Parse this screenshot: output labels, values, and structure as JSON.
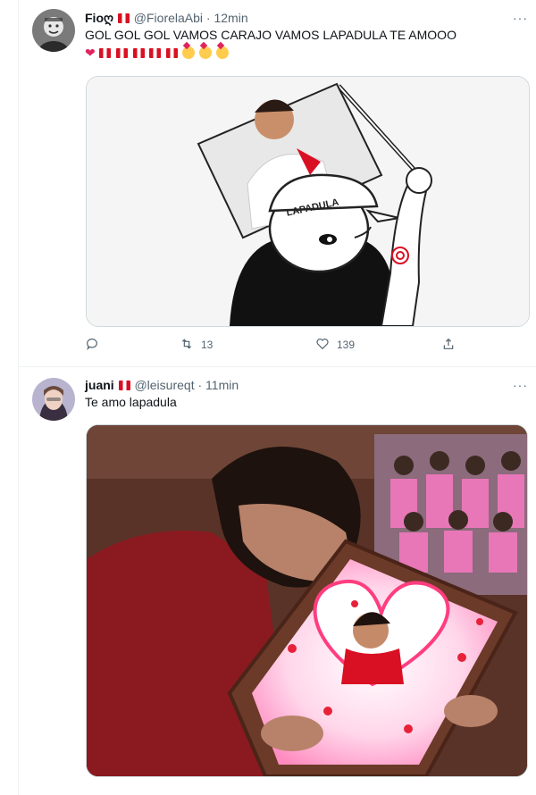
{
  "tweets": [
    {
      "display_name": "Fioღ",
      "handle": "@FiorelaAbi",
      "dot": "·",
      "time": "12min",
      "text": "GOL GOL GOL VAMOS CARAJO VAMOS LAPADULA TE AMOOO",
      "emoji_line": "❤️🇵🇪🇵🇪🇵🇪🇵🇪🇵🇪🥳🥳🥳",
      "media": {
        "type": "meme-drawing",
        "cap_text": "LAPADULA"
      },
      "reply_count": "",
      "retweet_count": "13",
      "like_count": "139",
      "more": "···"
    },
    {
      "display_name": "juani",
      "handle": "@leisureqt",
      "dot": "·",
      "time": "11min",
      "text": "Te amo lapadula",
      "media": {
        "type": "photo"
      },
      "more": "···"
    }
  ],
  "icons": {
    "reply": "reply-icon",
    "retweet": "retweet-icon",
    "like": "heart-icon",
    "share": "share-icon",
    "more": "more-icon",
    "flag": "peru-flag-icon"
  },
  "colors": {
    "text": "#0f1419",
    "secondary": "#536471",
    "border": "#eff3f4",
    "peru_red": "#d91023"
  }
}
